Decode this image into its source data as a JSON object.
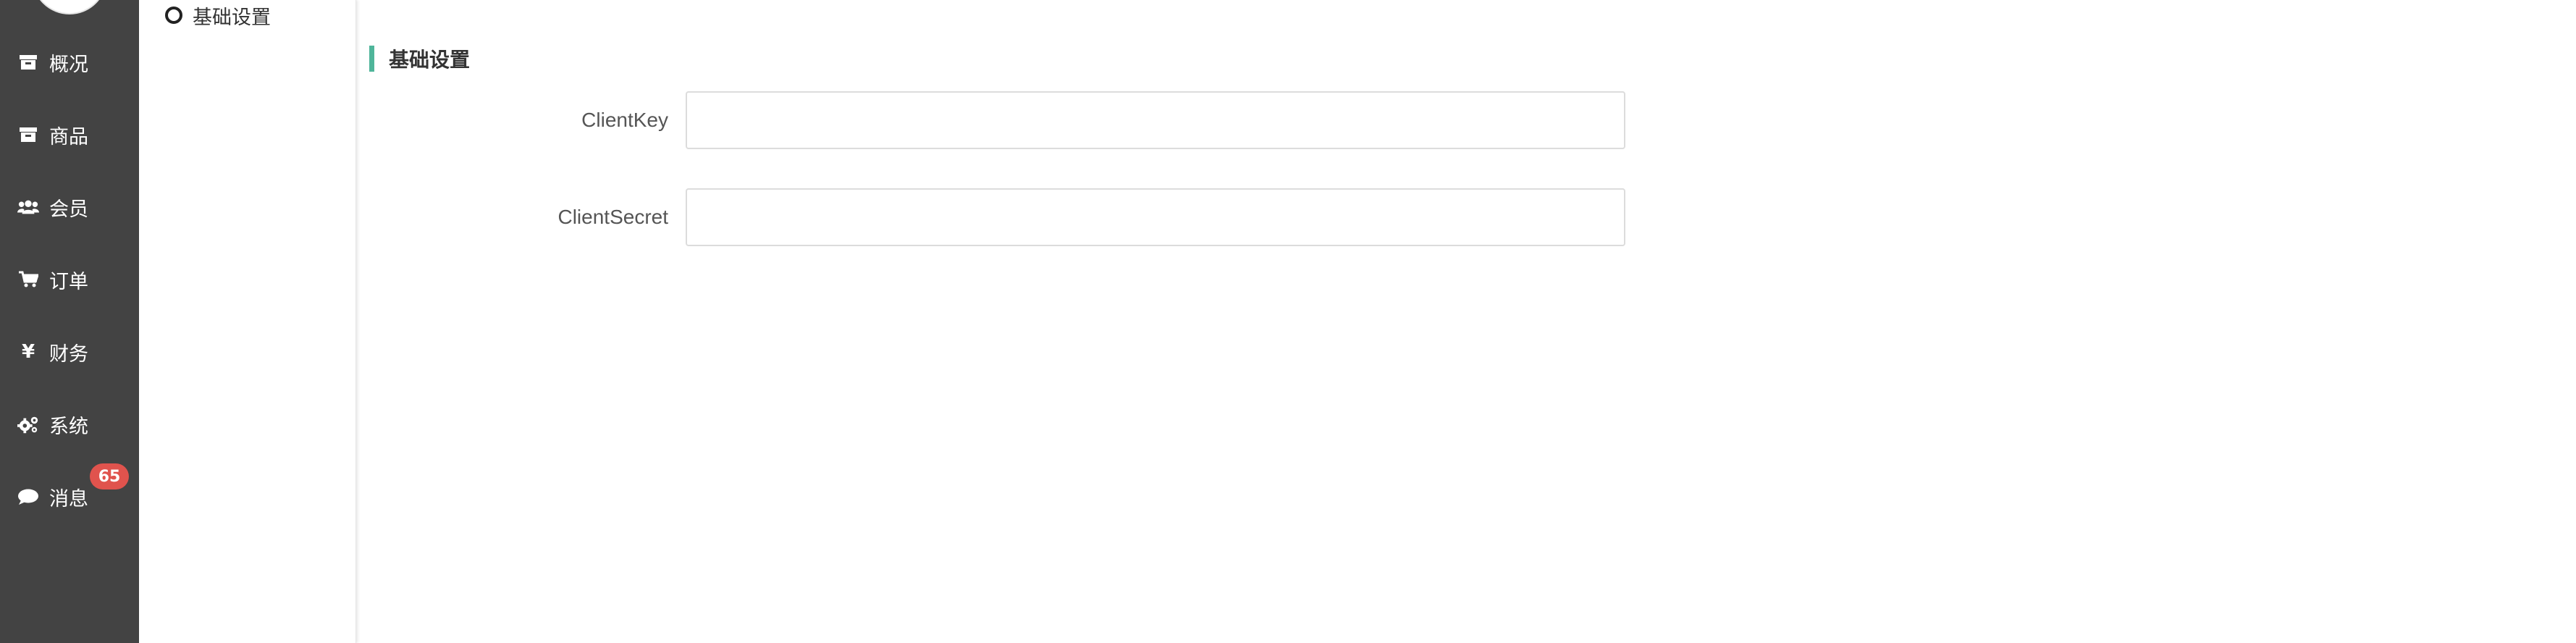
{
  "nav": {
    "items": [
      {
        "label": "概况",
        "icon": "archive-icon"
      },
      {
        "label": "商品",
        "icon": "archive-icon"
      },
      {
        "label": "会员",
        "icon": "users-icon"
      },
      {
        "label": "订单",
        "icon": "cart-icon"
      },
      {
        "label": "财务",
        "icon": "yen-icon"
      },
      {
        "label": "系统",
        "icon": "gears-icon"
      },
      {
        "label": "消息",
        "icon": "comment-icon",
        "badge": "65"
      }
    ]
  },
  "subnav": {
    "items": [
      {
        "label": "基础设置"
      }
    ]
  },
  "main": {
    "section_title": "基础设置",
    "fields": [
      {
        "label": "ClientKey",
        "value": ""
      },
      {
        "label": "ClientSecret",
        "value": ""
      }
    ]
  },
  "colors": {
    "nav_bg": "#434343",
    "accent": "#4fb59a",
    "badge": "#e0534d"
  }
}
